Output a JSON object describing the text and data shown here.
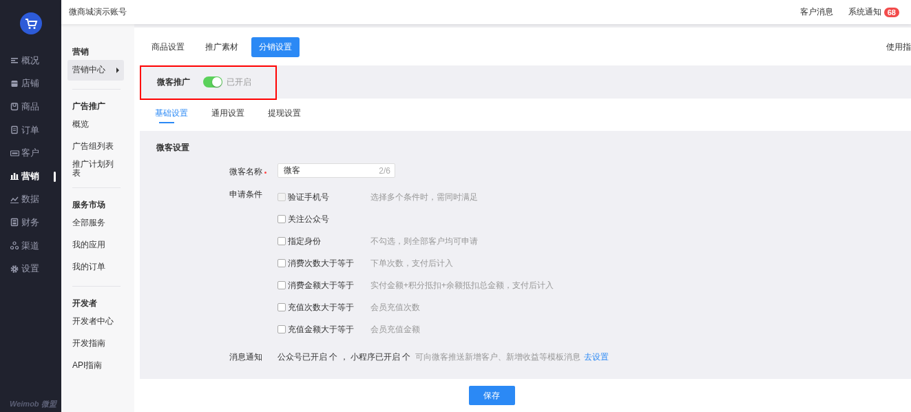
{
  "sidebar": {
    "items": [
      {
        "label": "概况",
        "selected": false
      },
      {
        "label": "店铺",
        "selected": false
      },
      {
        "label": "商品",
        "selected": false
      },
      {
        "label": "订单",
        "selected": false
      },
      {
        "label": "客户",
        "selected": false
      },
      {
        "label": "营销",
        "selected": true
      },
      {
        "label": "数据",
        "selected": false
      },
      {
        "label": "财务",
        "selected": false
      },
      {
        "label": "渠道",
        "selected": false
      },
      {
        "label": "设置",
        "selected": false
      }
    ],
    "brand": "Weimob 微盟"
  },
  "topbar": {
    "account": "微商城演示账号",
    "links": [
      "客户消息",
      "系统通知"
    ],
    "badge": "68"
  },
  "subnav": [
    {
      "heading": "营销",
      "items": [
        {
          "label": "营销中心",
          "selected": true,
          "has_submenu": true
        }
      ]
    },
    {
      "heading": "广告推广",
      "items": [
        {
          "label": "概览",
          "selected": false,
          "has_submenu": false
        },
        {
          "label": "广告组列表",
          "selected": false,
          "has_submenu": false
        },
        {
          "label": "推广计划列表",
          "selected": false,
          "has_submenu": false
        }
      ]
    },
    {
      "heading": "服务市场",
      "items": [
        {
          "label": "全部服务",
          "selected": false,
          "has_submenu": false
        },
        {
          "label": "我的应用",
          "selected": false,
          "has_submenu": false
        },
        {
          "label": "我的订单",
          "selected": false,
          "has_submenu": false
        }
      ]
    },
    {
      "heading": "开发者",
      "items": [
        {
          "label": "开发者中心",
          "selected": false,
          "has_submenu": false
        },
        {
          "label": "开发指南",
          "selected": false,
          "has_submenu": false
        },
        {
          "label": "API指南",
          "selected": false,
          "has_submenu": false
        }
      ]
    }
  ],
  "tabs": [
    {
      "label": "商品设置",
      "selected": false
    },
    {
      "label": "推广素材",
      "selected": false
    },
    {
      "label": "分销设置",
      "selected": true
    }
  ],
  "guide_link": "使用指",
  "promotion": {
    "label": "微客推广",
    "on": true,
    "status": "已开启",
    "highlighted": true
  },
  "subtabs": [
    {
      "label": "基础设置",
      "selected": true
    },
    {
      "label": "通用设置",
      "selected": false
    },
    {
      "label": "提现设置",
      "selected": false
    }
  ],
  "section_title": "微客设置",
  "name_field": {
    "label": "微客名称",
    "required": true,
    "value": "微客",
    "counter": "2/6"
  },
  "conditions": {
    "label": "申请条件",
    "items": [
      {
        "label": "验证手机号",
        "checked": false,
        "disabled": true,
        "hint": "选择多个条件时，需同时满足"
      },
      {
        "label": "关注公众号",
        "checked": false,
        "disabled": false
      },
      {
        "label": "指定身份",
        "checked": false,
        "disabled": false,
        "hint": "不勾选，则全部客户均可申请"
      },
      {
        "label": "消费次数大于等于",
        "checked": false,
        "disabled": false,
        "hint": "下单次数，支付后计入"
      },
      {
        "label": "消费金额大于等于",
        "checked": false,
        "disabled": false,
        "hint": "实付金额+积分抵扣+余额抵扣总金额，支付后计入"
      },
      {
        "label": "充值次数大于等于",
        "checked": false,
        "disabled": false,
        "hint": "会员充值次数"
      },
      {
        "label": "充值金额大于等于",
        "checked": false,
        "disabled": false,
        "hint": "会员充值金额"
      }
    ]
  },
  "notification": {
    "label": "消息通知",
    "status": "公众号已开启 个 ， 小程序已开启 个",
    "hint": "可向微客推送新增客户、新增收益等模板消息",
    "link": "去设置"
  },
  "save_button": "保存"
}
